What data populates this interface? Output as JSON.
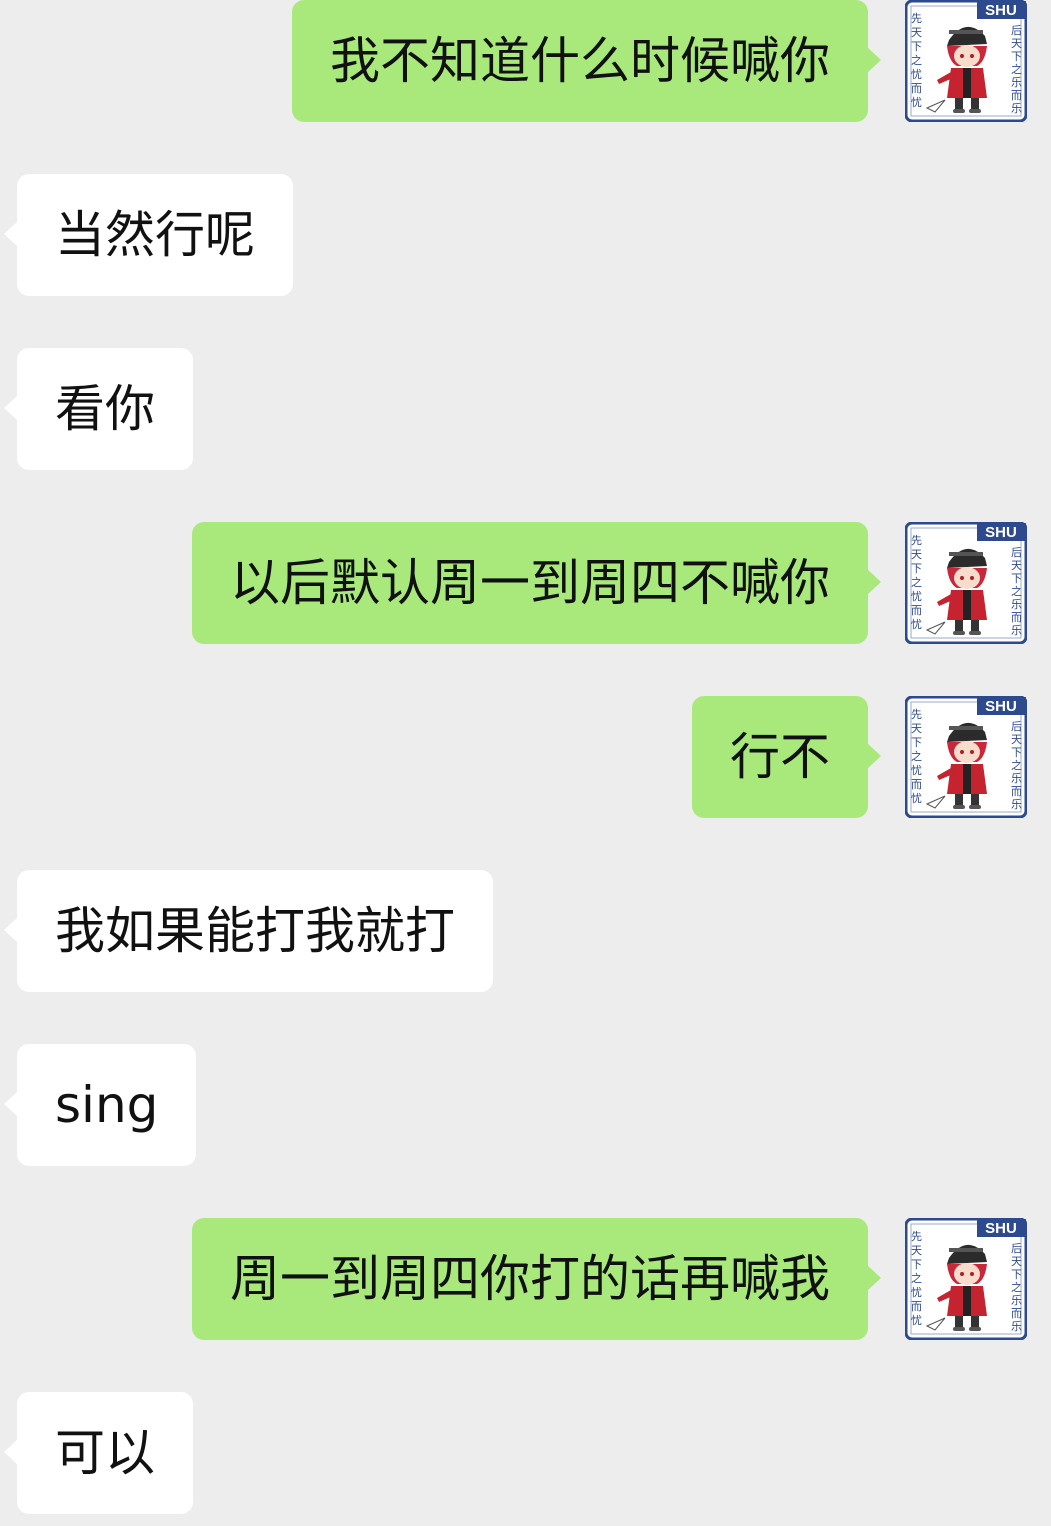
{
  "messages": [
    {
      "side": "out",
      "text": "我不知道什么时候喊你"
    },
    {
      "side": "in",
      "text": "当然行呢"
    },
    {
      "side": "in",
      "text": "看你"
    },
    {
      "side": "out",
      "text": "以后默认周一到周四不喊你"
    },
    {
      "side": "out",
      "text": "行不"
    },
    {
      "side": "in",
      "text": "我如果能打我就打"
    },
    {
      "side": "in",
      "text": "sing"
    },
    {
      "side": "out",
      "text": "周一到周四你打的话再喊我"
    },
    {
      "side": "in",
      "text": "可以"
    }
  ],
  "avatar": {
    "tag": "SHU",
    "left_text": "先天下之忧而忧",
    "right_text": "后天下之乐而乐",
    "icon": "anime-character-avatar"
  },
  "colors": {
    "background": "#ededed",
    "incoming_bubble": "#ffffff",
    "outgoing_bubble": "#a9e97c",
    "avatar_frame": "#2e4a8e"
  }
}
